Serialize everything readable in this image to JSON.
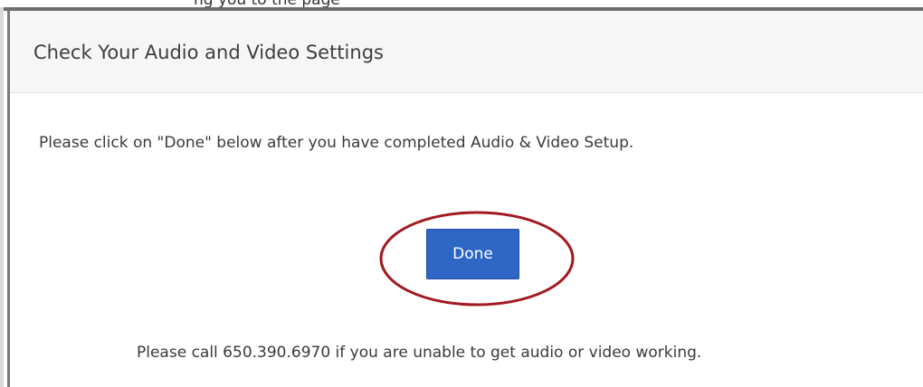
{
  "top_fragment": {
    "text": "ng you to the page"
  },
  "modal": {
    "title": "Check Your Audio and Video Settings",
    "instruction": "Please click on \"Done\" below after you have completed Audio & Video Setup.",
    "done_label": "Done",
    "support_text": "Please call 650.390.6970 if you are unable to get audio or video working."
  },
  "colors": {
    "button": "#2e66c6",
    "highlight": "#a11a20",
    "header_background": "#f6f6f6"
  }
}
